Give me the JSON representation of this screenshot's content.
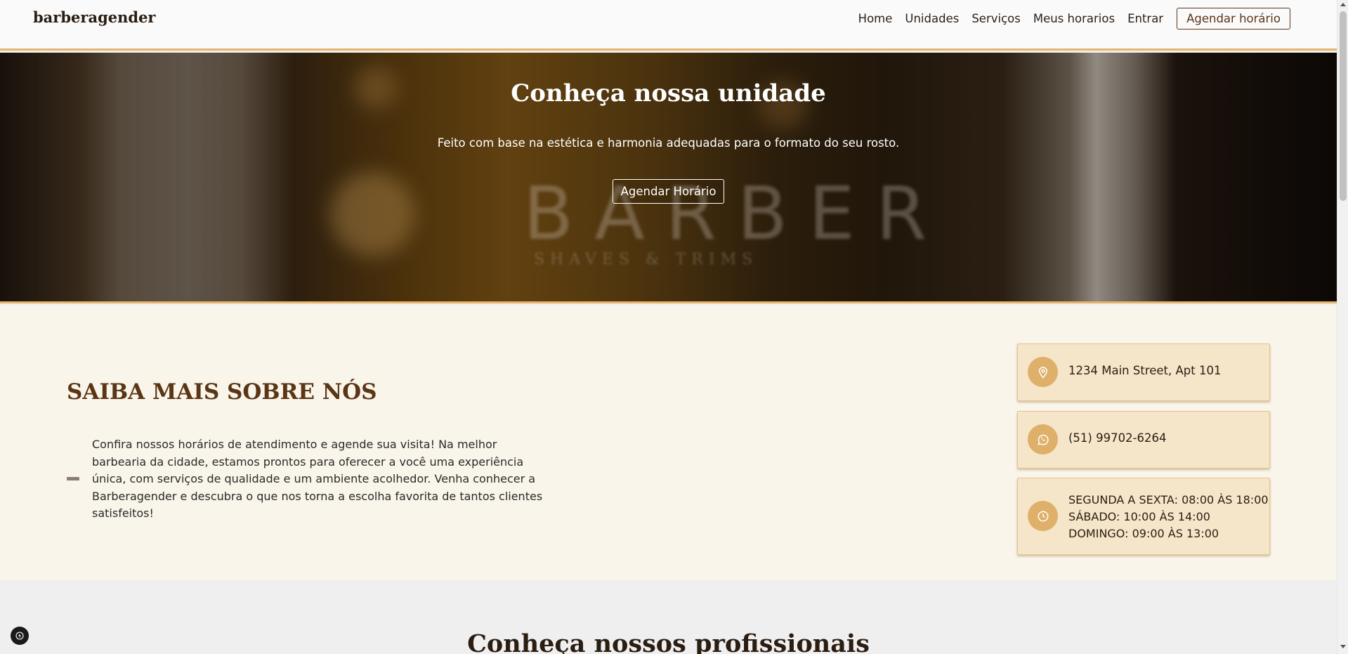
{
  "navbar": {
    "brand": "barberagender",
    "links": [
      "Home",
      "Unidades",
      "Serviços",
      "Meus horarios",
      "Entrar"
    ],
    "cta": "Agendar horário"
  },
  "hero": {
    "title": "Conheça nossa unidade",
    "subtitle": "Feito com base na estética e harmonia adequadas para o formato do seu rosto.",
    "button": "Agendar Horário",
    "watermark_main": "BARBER",
    "watermark_sub": "SHAVES & TRIMS"
  },
  "about": {
    "title": "SAIBA MAIS SOBRE NÓS",
    "text": "Confira nossos horários de atendimento e agende sua visita! Na melhor barbearia da cidade, estamos prontos para oferecer a você uma experiência única, com serviços de qualidade e um ambiente acolhedor. Venha conhecer a Barberagender e descubra o que nos torna a escolha favorita de tantos clientes satisfeitos!"
  },
  "info": {
    "address": "1234 Main Street, Apt 101",
    "phone": "(51) 99702-6264",
    "hours": [
      "SEGUNDA A SEXTA: 08:00 ÀS 18:00",
      "SÁBADO: 10:00 ÀS 14:00",
      "DOMINGO: 09:00 ÀS 13:00"
    ],
    "icons": [
      "map-pin-icon",
      "whatsapp-icon",
      "clock-icon"
    ]
  },
  "pros": {
    "title": "Conheça nossos profissionais"
  },
  "colors": {
    "accent": "#e6b46a",
    "brown": "#5a3516",
    "cream": "#faf5ea",
    "card": "#f5e6c9",
    "icon_bg": "#deb06a"
  }
}
